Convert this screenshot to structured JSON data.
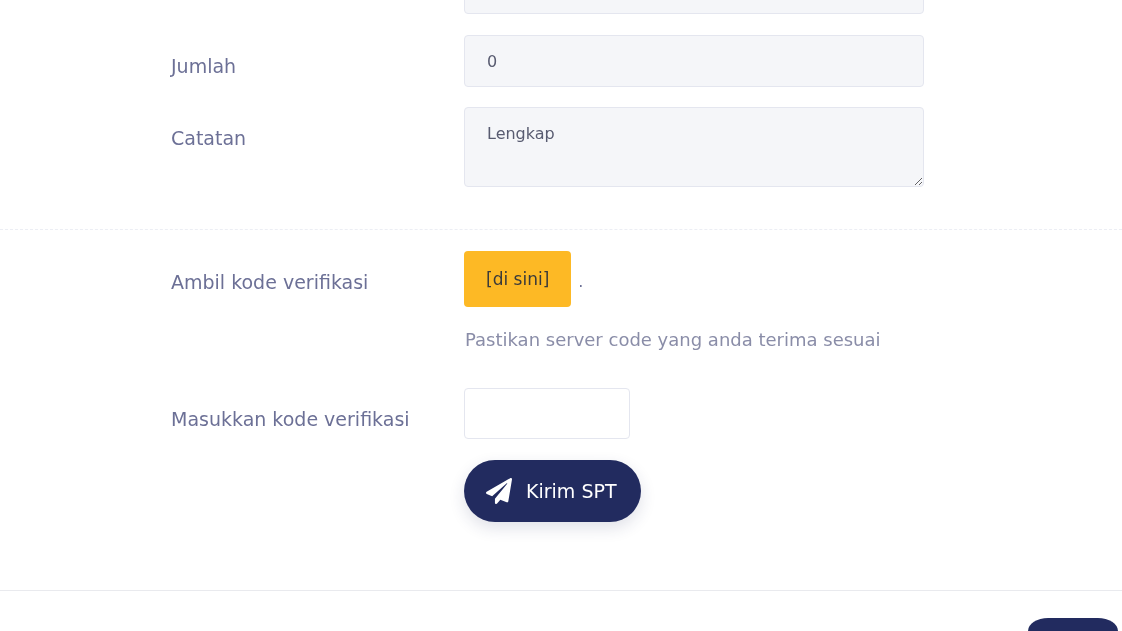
{
  "form": {
    "details": [
      {
        "kind": "input"
      },
      {
        "kind": "input",
        "label": "Jumlah",
        "value": "0"
      },
      {
        "kind": "textarea",
        "label": "Catatan",
        "value": "Lengkap"
      }
    ],
    "verification": {
      "fetch_label": "Ambil kode verifikasi",
      "fetch_button": "[di sini]",
      "fetch_suffix": ".",
      "hint": "Pastikan server code yang anda terima sesuai",
      "code_label": "Masukkan kode verifikasi",
      "submit_button": "Kirim SPT"
    }
  }
}
